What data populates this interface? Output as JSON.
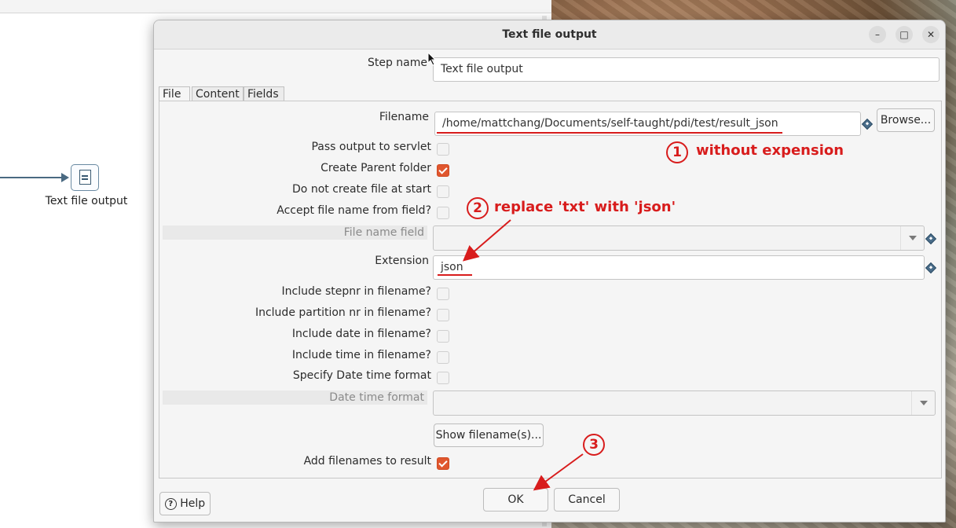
{
  "canvas": {
    "step_label": "Text file output"
  },
  "dialog": {
    "title": "Text file output",
    "step_name_label": "Step name",
    "step_name_value": "Text file output",
    "tabs": [
      "File",
      "Content",
      "Fields"
    ],
    "filename_label": "Filename",
    "filename_value": "/home/mattchang/Documents/self-taught/pdi/test/result_json",
    "browse_label": "Browse...",
    "pass_output_label": "Pass output to servlet",
    "create_parent_label": "Create Parent folder",
    "no_create_label": "Do not create file at start",
    "accept_name_label": "Accept file name from field?",
    "file_name_field_label": "File name field",
    "extension_label": "Extension",
    "extension_value": "json",
    "include_stepnr_label": "Include stepnr in filename?",
    "include_partition_label": "Include partition nr in filename?",
    "include_date_label": "Include date in filename?",
    "include_time_label": "Include time in filename?",
    "specify_datetime_label": "Specify Date time format",
    "datetime_format_label": "Date time format",
    "show_filenames_label": "Show filename(s)...",
    "add_filenames_label": "Add filenames to result",
    "checkbox_states": {
      "pass_output": false,
      "create_parent": true,
      "no_create": false,
      "accept_name": false,
      "include_stepnr": false,
      "include_partition": false,
      "include_date": false,
      "include_time": false,
      "specify_datetime": false,
      "add_filenames": true
    },
    "help_label": "Help",
    "ok_label": "OK",
    "cancel_label": "Cancel"
  },
  "annotations": {
    "n1": "1",
    "text1": "without expension",
    "n2": "2",
    "text2": "replace 'txt' with 'json'",
    "n3": "3",
    "color": "#d81c1c"
  },
  "window_controls": {
    "minimize": "–",
    "maximize": "□",
    "close": "✕"
  }
}
